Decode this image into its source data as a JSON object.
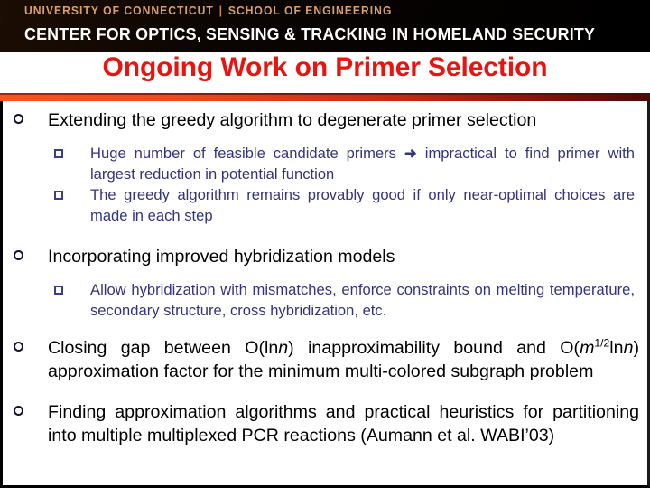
{
  "header": {
    "institution": "UNIVERSITY OF CONNECTICUT",
    "divider": "|",
    "school": "SCHOOL OF ENGINEERING",
    "center": "CENTER FOR OPTICS, SENSING & TRACKING IN HOMELAND SECURITY"
  },
  "title": "Ongoing Work on Primer Selection",
  "bullets": {
    "b1": "Extending the greedy algorithm to degenerate primer selection",
    "b1s1_a": "Huge number of feasible candidate primers",
    "b1s1_arrow": "➜",
    "b1s1_b": "impractical to find primer with largest reduction in potential function",
    "b1s2": "The greedy algorithm remains provably good if only near-optimal choices are made in each step",
    "b2": "Incorporating improved hybridization models",
    "b2s1": "Allow hybridization with mismatches, enforce constraints on melting temperature, secondary structure, cross hybridization, etc.",
    "b3_p1": "Closing gap between O(ln",
    "b3_v1": "n",
    "b3_p2": ") inapproximability bound and O(",
    "b3_v2": "m",
    "b3_sup": "1/2",
    "b3_p3": "ln",
    "b3_v3": "n",
    "b3_p4": ") approximation factor for the minimum multi-colored subgraph problem",
    "b4": "Finding approximation algorithms and practical heuristics for partitioning into multiple multiplexed PCR reactions (Aumann et al. WABI’03)"
  },
  "colors": {
    "title_red": "#e8140f",
    "banner_black": "#0a0402",
    "banner_tan": "#d9a066",
    "sub_bullet_navy": "#34347e",
    "rule_orange": "#f4561d",
    "rule_dark": "#4c0a07"
  }
}
